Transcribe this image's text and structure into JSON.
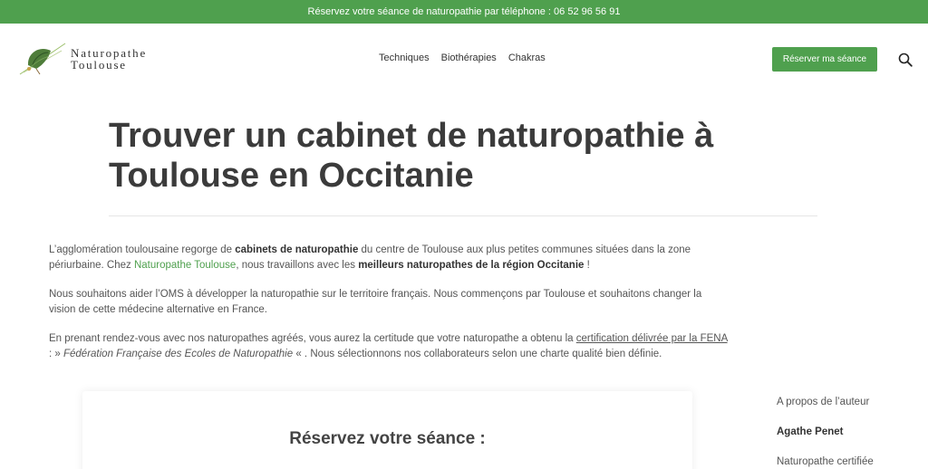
{
  "topbar": {
    "text": "Réservez votre séance de naturopathie par téléphone : 06 52 96 56 91"
  },
  "logo": {
    "line1": "Naturopathe",
    "line2": "Toulouse"
  },
  "nav": {
    "items": [
      "Techniques",
      "Biothérapies",
      "Chakras"
    ]
  },
  "cta": {
    "label": "Réserver ma séance"
  },
  "icons": {
    "search": "search-icon",
    "logo": "ginkgo-leaf-icon"
  },
  "colors": {
    "brand_green": "#4fa04e",
    "heading": "#3b3b3b"
  },
  "page": {
    "title": "Trouver un cabinet de naturopathie à Toulouse en Occitanie",
    "p1": {
      "a": "L’agglomération toulousaine regorge de ",
      "b": "cabinets de naturopathie",
      "c": " du centre de Toulouse aux plus petites communes situées dans la zone périurbaine. Chez ",
      "link": "Naturopathe Toulouse",
      "d": ", nous travaillons avec les ",
      "e": "meilleurs naturopathes de la région Occitanie",
      "f": " !"
    },
    "p2": "Nous souhaitons aider l’OMS à développer la naturopathie sur le territoire français. Nous commençons par Toulouse et souhaitons changer la vision de cette médecine alternative en France.",
    "p3": {
      "a": "En prenant rendez-vous avec nos naturopathes agréés, vous aurez la certitude que votre naturopathe a obtenu la ",
      "link": "certification délivrée par la FENA",
      "b": " :  » ",
      "italic": "Fédération Française des Ecoles de Naturopathie",
      "c": " « . Nous sélectionnons nos collaborateurs selon une charte qualité bien définie."
    }
  },
  "card": {
    "title": "Réservez votre séance :"
  },
  "aside": {
    "about": "A propos de l’auteur",
    "name": "Agathe Penet",
    "role": "Naturopathe certifiée"
  }
}
